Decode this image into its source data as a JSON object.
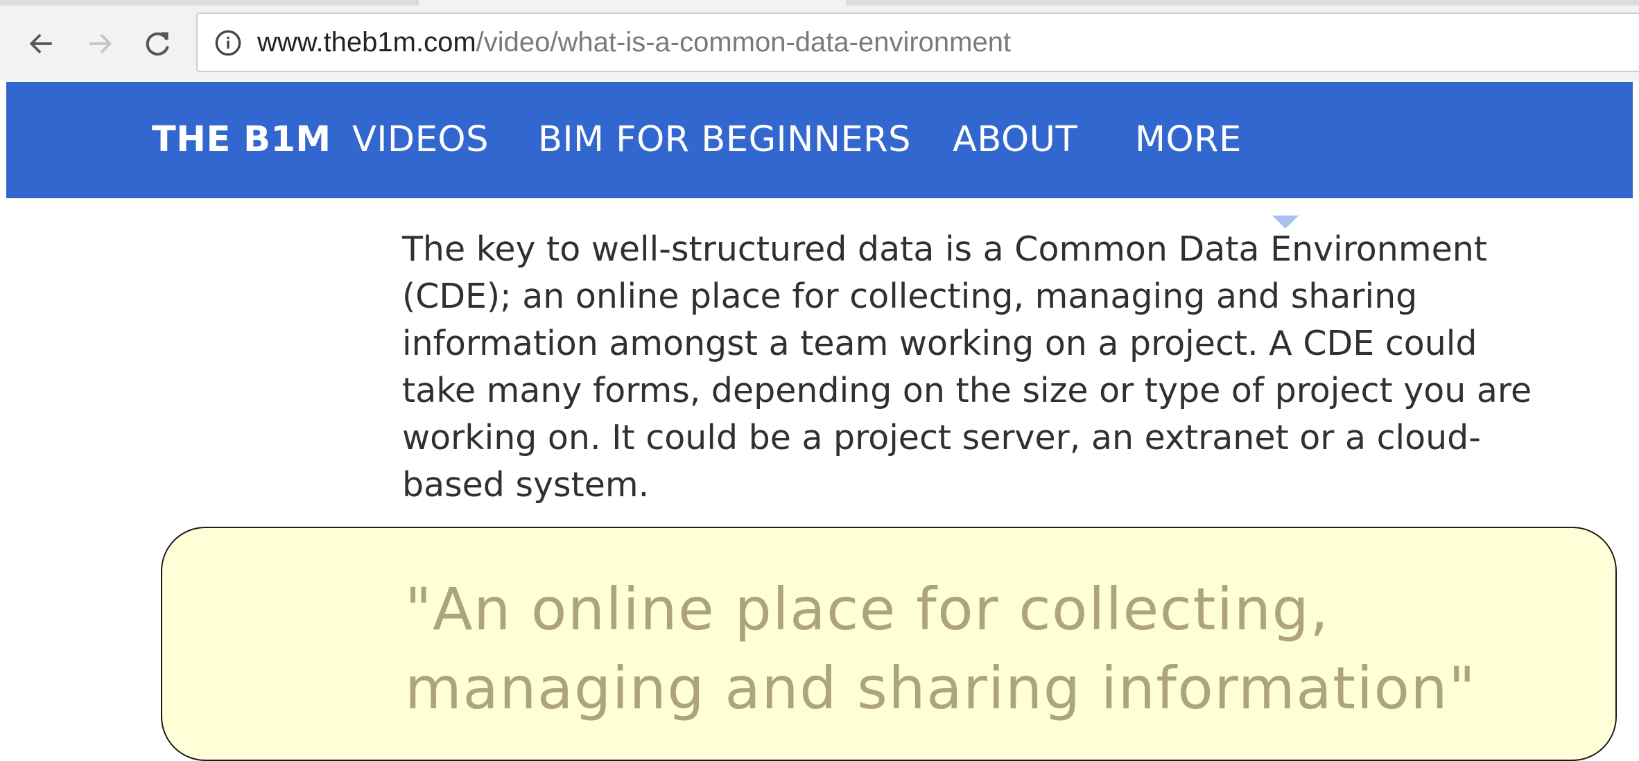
{
  "browser": {
    "back_icon": "arrow-left-icon",
    "forward_icon": "arrow-right-icon",
    "reload_icon": "reload-icon",
    "info_icon": "info-icon",
    "url_host": "www.theb1m.com",
    "url_path": "/video/what-is-a-common-data-environment"
  },
  "site_nav": {
    "brand": "THE B1M",
    "items": [
      {
        "label": "VIDEOS"
      },
      {
        "label": "BIM FOR BEGINNERS"
      },
      {
        "label": "ABOUT"
      },
      {
        "label": "MORE"
      }
    ],
    "background": "#3367d0"
  },
  "article": {
    "paragraph": "The key to well-structured data is a Common Data Environment (CDE); an online place for collecting, managing and sharing information amongst a team working on a project. A CDE could take many forms, depending on the size or type of project you are working on. It could be a project server, an extranet or a cloud-based system.",
    "quote": "\"An online place for collecting, managing and sharing information\""
  }
}
